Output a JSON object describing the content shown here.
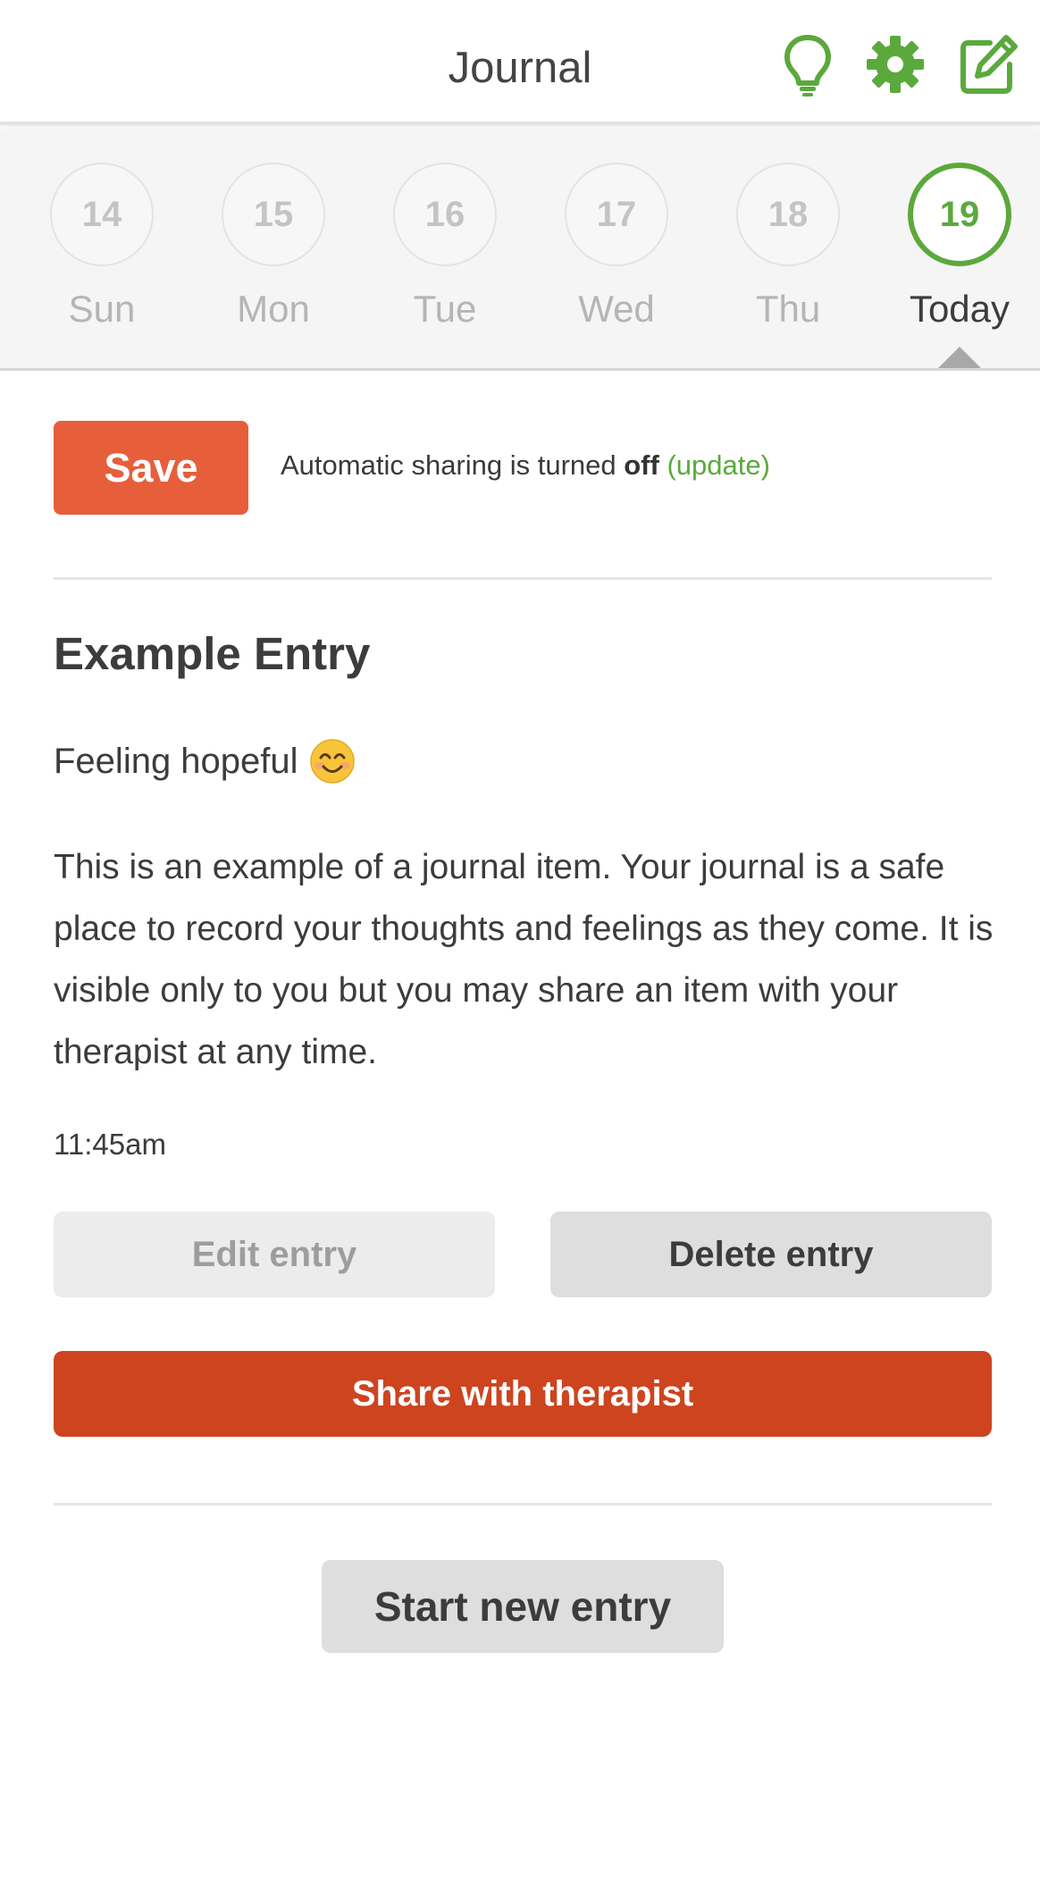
{
  "header": {
    "title": "Journal",
    "icons": [
      "lightbulb-icon",
      "gear-icon",
      "edit-icon"
    ],
    "accent_color": "#5ba93c"
  },
  "date_strip": {
    "days": [
      {
        "number": "14",
        "label": "Sun"
      },
      {
        "number": "15",
        "label": "Mon"
      },
      {
        "number": "16",
        "label": "Tue"
      },
      {
        "number": "17",
        "label": "Wed"
      },
      {
        "number": "18",
        "label": "Thu"
      },
      {
        "number": "19",
        "label": "Today",
        "selected": true
      }
    ]
  },
  "save_row": {
    "save_label": "Save",
    "sharing_prefix": "Automatic sharing is turned ",
    "sharing_state": "off",
    "update_link": "(update)",
    "save_color": "#e65f3a"
  },
  "entry": {
    "title": "Example Entry",
    "mood_text": "Feeling hopeful",
    "mood_emoji": "smiling-face-emoji",
    "body": "This is an example of a journal item. Your journal is a safe place to record your thoughts and feelings as they come. It is visible only to you but you may share an item with your therapist at any time.",
    "time": "11:45am"
  },
  "actions": {
    "edit_label": "Edit entry",
    "delete_label": "Delete entry",
    "share_label": "Share with therapist",
    "share_color": "#cd441f",
    "new_entry_label": "Start new entry"
  }
}
